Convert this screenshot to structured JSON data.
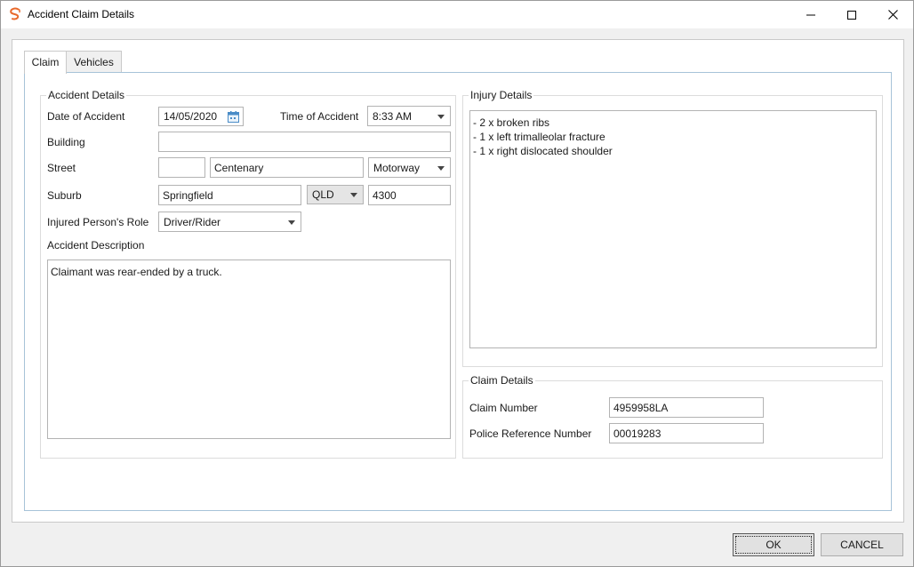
{
  "window": {
    "title": "Accident Claim Details",
    "icon": "brand-swirl-icon",
    "controls": [
      "minimize-icon",
      "maximize-icon",
      "close-icon"
    ]
  },
  "tabs": [
    {
      "label": "Claim",
      "active": true
    },
    {
      "label": "Vehicles",
      "active": false
    }
  ],
  "accident": {
    "legend": "Accident Details",
    "date_label": "Date of Accident",
    "date_value": "14/05/2020",
    "time_label": "Time of Accident",
    "time_value": "8:33 AM",
    "building_label": "Building",
    "building_value": "",
    "street_label": "Street",
    "street_number": "",
    "street_name": "Centenary",
    "street_type": "Motorway",
    "suburb_label": "Suburb",
    "suburb_value": "Springfield",
    "state_value": "QLD",
    "postcode_value": "4300",
    "role_label": "Injured Person's Role",
    "role_value": "Driver/Rider",
    "description_label": "Accident Description",
    "description_value": "Claimant was rear-ended by a truck."
  },
  "injury": {
    "legend": "Injury Details",
    "text": "- 2 x broken ribs\n- 1 x left trimalleolar fracture\n- 1 x right dislocated shoulder"
  },
  "claim": {
    "legend": "Claim Details",
    "claim_number_label": "Claim Number",
    "claim_number_value": "4959958LA",
    "police_ref_label": "Police Reference Number",
    "police_ref_value": "00019283"
  },
  "buttons": {
    "ok": "OK",
    "cancel": "CANCEL"
  },
  "colors": {
    "brand": "#e8692b",
    "tab_border": "#a7c3d8"
  }
}
